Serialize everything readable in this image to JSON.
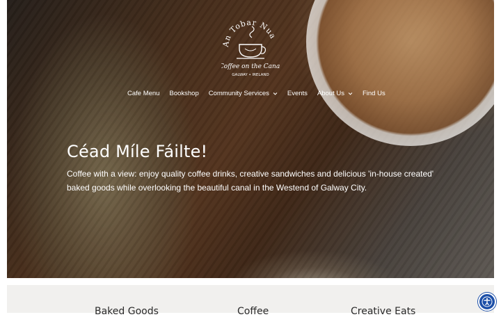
{
  "logo": {
    "arc_text": "An Tobar Nua",
    "script_text": "Coffee on the Canal",
    "location": "GALWAY • IRELAND"
  },
  "nav": [
    {
      "label": "Cafe Menu",
      "dropdown": false
    },
    {
      "label": "Bookshop",
      "dropdown": false
    },
    {
      "label": "Community Services",
      "dropdown": true
    },
    {
      "label": "Events",
      "dropdown": false
    },
    {
      "label": "About Us",
      "dropdown": true
    },
    {
      "label": "Find Us",
      "dropdown": false
    }
  ],
  "hero": {
    "title": "Céad Míle Fáilte!",
    "text": "Coffee with a view: enjoy quality coffee drinks, creative sandwiches and delicious 'in-house created' baked goods while overlooking the beautiful canal in the Westend of Galway City."
  },
  "features": [
    "Baked Goods",
    "Coffee",
    "Creative Eats"
  ],
  "icons": {
    "chevron": "chevron-down-icon",
    "accessibility": "accessibility-icon"
  },
  "colors": {
    "accessibility_button": "#1c4fa8",
    "band": "#f1f0ee"
  }
}
